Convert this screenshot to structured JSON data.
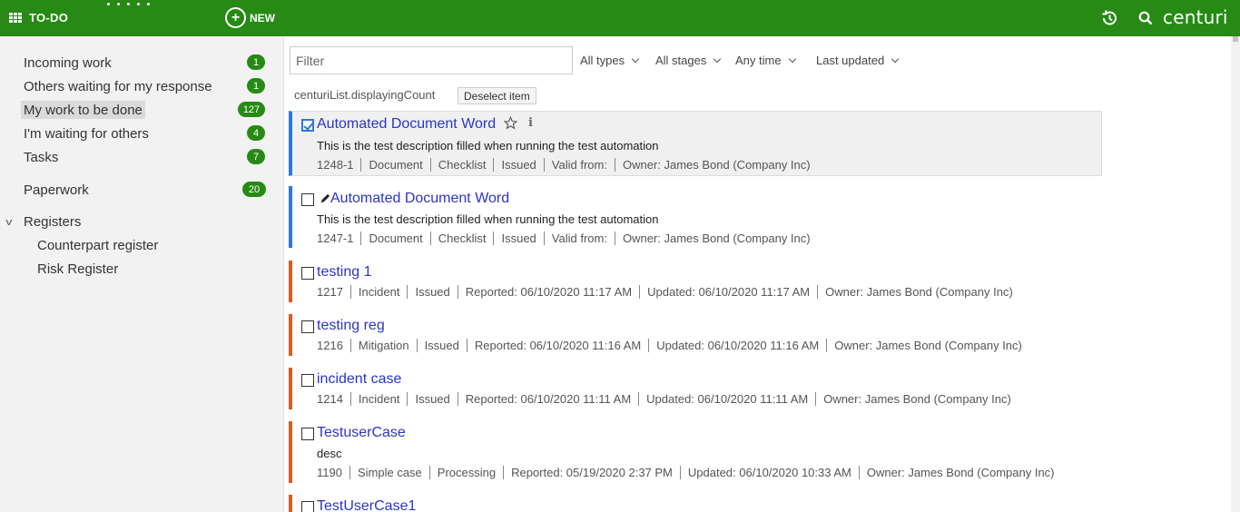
{
  "topbar": {
    "todo_label": "TO-DO",
    "new_label": "NEW",
    "brand": "centuri",
    "background": "#278a15"
  },
  "sidebar": {
    "items": [
      {
        "label": "Incoming work",
        "count": "1"
      },
      {
        "label": "Others waiting for my response",
        "count": "1"
      },
      {
        "label": "My work to be done",
        "count": "127"
      },
      {
        "label": "I'm waiting for others",
        "count": "4"
      },
      {
        "label": "Tasks",
        "count": "7"
      },
      {
        "label": "Paperwork",
        "count": "20"
      }
    ],
    "registers": {
      "label": "Registers",
      "items": [
        "Counterpart register",
        "Risk Register"
      ]
    }
  },
  "toolbar": {
    "filter_placeholder": "Filter",
    "types": "All types",
    "stages": "All stages",
    "time": "Any time",
    "sort": "Last updated",
    "count_text": "centuriList.displayingCount",
    "deselect_label": "Deselect item"
  },
  "items": [
    {
      "title": "Automated Document Word",
      "desc": "This is the test description filled when running the test automation",
      "meta": [
        "1248-1",
        "Document",
        "Checklist",
        "Issued",
        "Valid from:",
        "Owner: James Bond (Company Inc)"
      ]
    },
    {
      "title": "Automated Document Word",
      "desc": "This is the test description filled when running the test automation",
      "meta": [
        "1247-1",
        "Document",
        "Checklist",
        "Issued",
        "Valid from:",
        "Owner: James Bond (Company Inc)"
      ]
    },
    {
      "title": "testing 1",
      "meta": [
        "1217",
        "Incident",
        "Issued",
        "Reported: 06/10/2020 11:17 AM",
        "Updated: 06/10/2020 11:17 AM",
        "Owner: James Bond (Company Inc)"
      ]
    },
    {
      "title": "testing reg",
      "meta": [
        "1216",
        "Mitigation",
        "Issued",
        "Reported: 06/10/2020 11:16 AM",
        "Updated: 06/10/2020 11:16 AM",
        "Owner: James Bond (Company Inc)"
      ]
    },
    {
      "title": "incident case",
      "meta": [
        "1214",
        "Incident",
        "Issued",
        "Reported: 06/10/2020 11:11 AM",
        "Updated: 06/10/2020 11:11 AM",
        "Owner: James Bond (Company Inc)"
      ]
    },
    {
      "title": "TestuserCase",
      "desc": "desc",
      "meta": [
        "1190",
        "Simple case",
        "Processing",
        "Reported: 05/19/2020 2:37 PM",
        "Updated: 06/10/2020 10:33 AM",
        "Owner: James Bond (Company Inc)"
      ]
    },
    {
      "title": "TestUserCase1"
    }
  ]
}
